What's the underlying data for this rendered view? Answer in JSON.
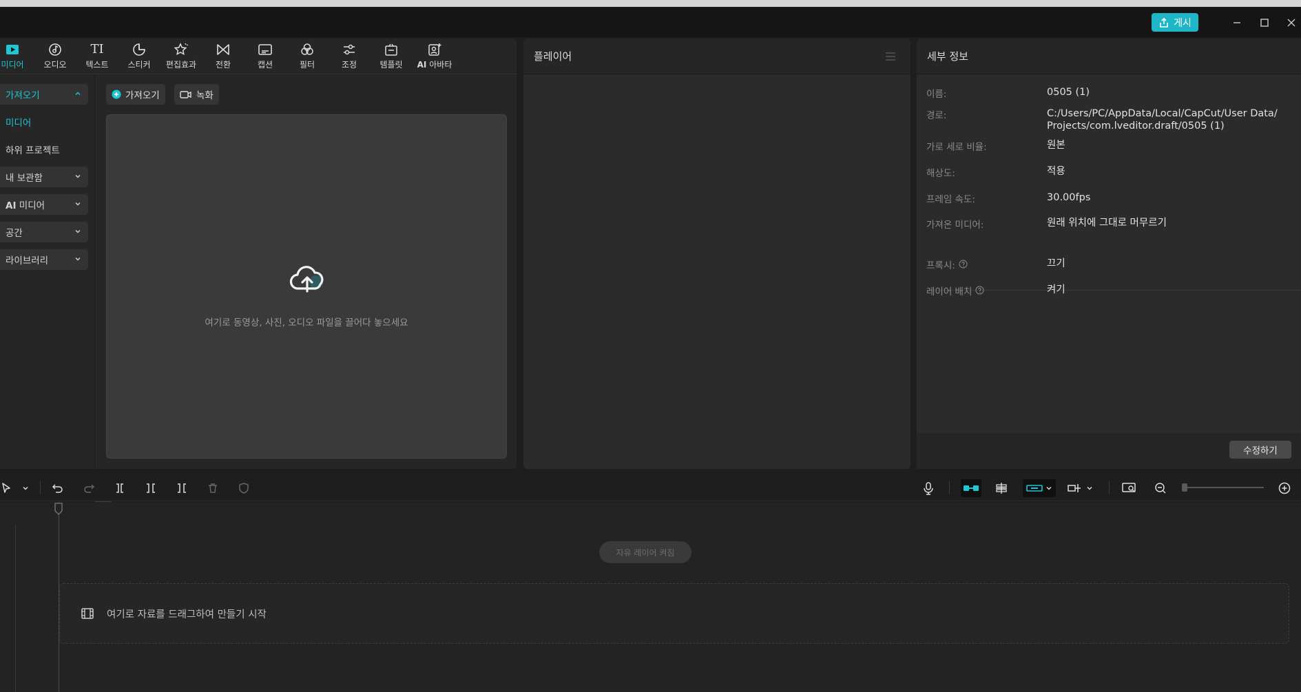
{
  "titlebar": {
    "publish_label": "게시"
  },
  "toolbar": {
    "tabs": [
      {
        "label": "미디어",
        "icon": "media-icon"
      },
      {
        "label": "오디오",
        "icon": "audio-icon"
      },
      {
        "label": "텍스트",
        "icon": "text-icon"
      },
      {
        "label": "스티커",
        "icon": "sticker-icon"
      },
      {
        "label": "편집효과",
        "icon": "effects-icon"
      },
      {
        "label": "전환",
        "icon": "transition-icon"
      },
      {
        "label": "캡션",
        "icon": "caption-icon"
      },
      {
        "label": "필터",
        "icon": "filter-icon"
      },
      {
        "label": "조정",
        "icon": "adjust-icon"
      },
      {
        "label": "템플릿",
        "icon": "template-icon"
      },
      {
        "label_prefix": "AI",
        "label": "아바타",
        "icon": "ai-avatar-icon"
      }
    ],
    "text_glyph": "TI"
  },
  "sidebar": {
    "items": [
      {
        "label": "가져오기"
      },
      {
        "label": "미디어"
      },
      {
        "label": "하위 프로젝트"
      },
      {
        "label": "내 보관함"
      },
      {
        "label_prefix": "AI",
        "label": "미디어"
      },
      {
        "label": "공간"
      },
      {
        "label": "라이브러리"
      }
    ]
  },
  "media": {
    "import_label": "가져오기",
    "record_label": "녹화",
    "drop_hint": "여기로 동영상, 사진, 오디오 파일을 끌어다 놓으세요"
  },
  "player": {
    "title": "플레이어"
  },
  "details": {
    "title": "세부 정보",
    "rows": [
      {
        "label": "이름:",
        "value": "0505 (1)"
      },
      {
        "label": "경로:",
        "value": "C:/Users/PC/AppData/Local/CapCut/User Data/Projects/com.lveditor.draft/0505 (1)"
      },
      {
        "label": "가로 세로 비율:",
        "value": "원본"
      },
      {
        "label": "해상도:",
        "value": "적용"
      },
      {
        "label": "프레임 속도:",
        "value": "30.00fps"
      },
      {
        "label": "가져온 미디어:",
        "value": "원래 위치에 그대로 머무르기"
      },
      {
        "label": "프록시:",
        "value": "끄기"
      },
      {
        "label": "레이어 배치",
        "value": "켜기"
      }
    ],
    "edit_label": "수정하기"
  },
  "timeline": {
    "free_layer_label": "자유 레이어 켜짐",
    "drop_hint": "여기로 자료를 드래그하여 만들기 시작"
  },
  "colors": {
    "accent": "#1fc6d6",
    "publish": "#1fb7c7"
  }
}
